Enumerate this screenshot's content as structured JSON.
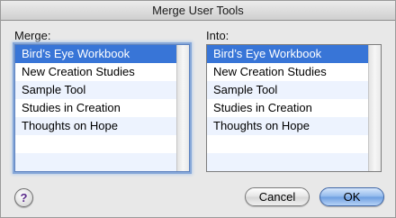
{
  "window": {
    "title": "Merge User Tools"
  },
  "merge": {
    "label": "Merge:",
    "items": [
      {
        "label": "Bird’s Eye Workbook"
      },
      {
        "label": "New Creation Studies"
      },
      {
        "label": "Sample Tool"
      },
      {
        "label": "Studies in Creation"
      },
      {
        "label": "Thoughts on Hope"
      }
    ],
    "selected_index": 0
  },
  "into": {
    "label": "Into:",
    "items": [
      {
        "label": "Bird’s Eye Workbook"
      },
      {
        "label": "New Creation Studies"
      },
      {
        "label": "Sample Tool"
      },
      {
        "label": "Studies in Creation"
      },
      {
        "label": "Thoughts on Hope"
      }
    ],
    "selected_index": 0
  },
  "buttons": {
    "help_icon": "?",
    "cancel_label": "Cancel",
    "ok_label": "OK"
  },
  "colors": {
    "selection": "#3875d7",
    "alt_row": "#edf3fe",
    "focus_ring": "#86a7d8"
  }
}
